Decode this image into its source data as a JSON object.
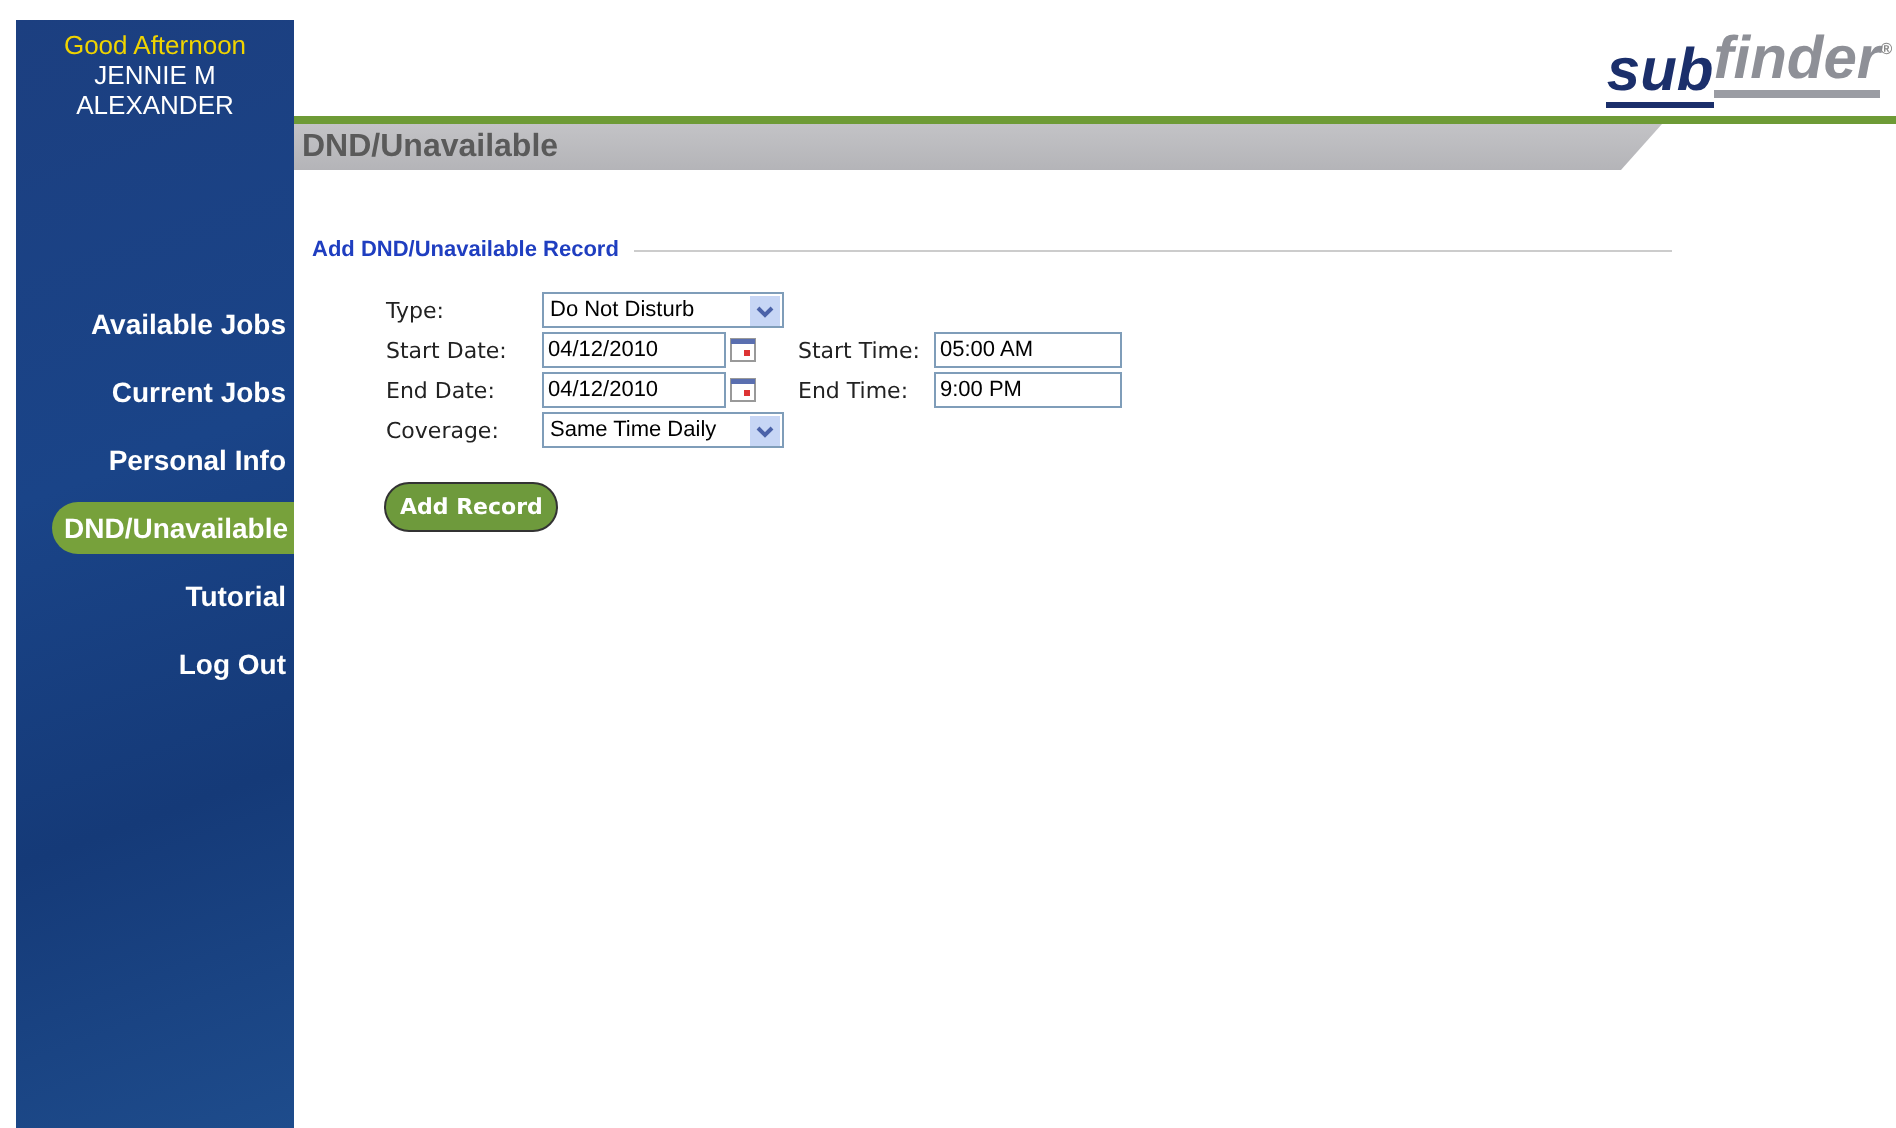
{
  "user": {
    "greeting": "Good Afternoon",
    "name_lines": [
      "JENNIE M",
      "ALEXANDER"
    ]
  },
  "nav": [
    {
      "label": "Available Jobs",
      "selected": false
    },
    {
      "label": "Current Jobs",
      "selected": false
    },
    {
      "label": "Personal Info",
      "selected": false
    },
    {
      "label": "DND/Unavailable",
      "selected": true
    },
    {
      "label": "Tutorial",
      "selected": false
    },
    {
      "label": "Log Out",
      "selected": false
    }
  ],
  "logo": {
    "part_1": "sub",
    "part_2": "finder",
    "mark": "®"
  },
  "page_title": "DND/Unavailable",
  "section_title": "Add DND/Unavailable Record",
  "form": {
    "type": {
      "label": "Type:",
      "value": "Do Not Disturb"
    },
    "start_date": {
      "label": "Start Date:",
      "value": "04/12/2010"
    },
    "start_time": {
      "label": "Start Time:",
      "value": "05:00 AM"
    },
    "end_date": {
      "label": "End Date:",
      "value": "04/12/2010"
    },
    "end_time": {
      "label": "End Time:",
      "value": "9:00 PM"
    },
    "coverage": {
      "label": "Coverage:",
      "value": "Same Time Daily"
    }
  },
  "button": "Add Record"
}
